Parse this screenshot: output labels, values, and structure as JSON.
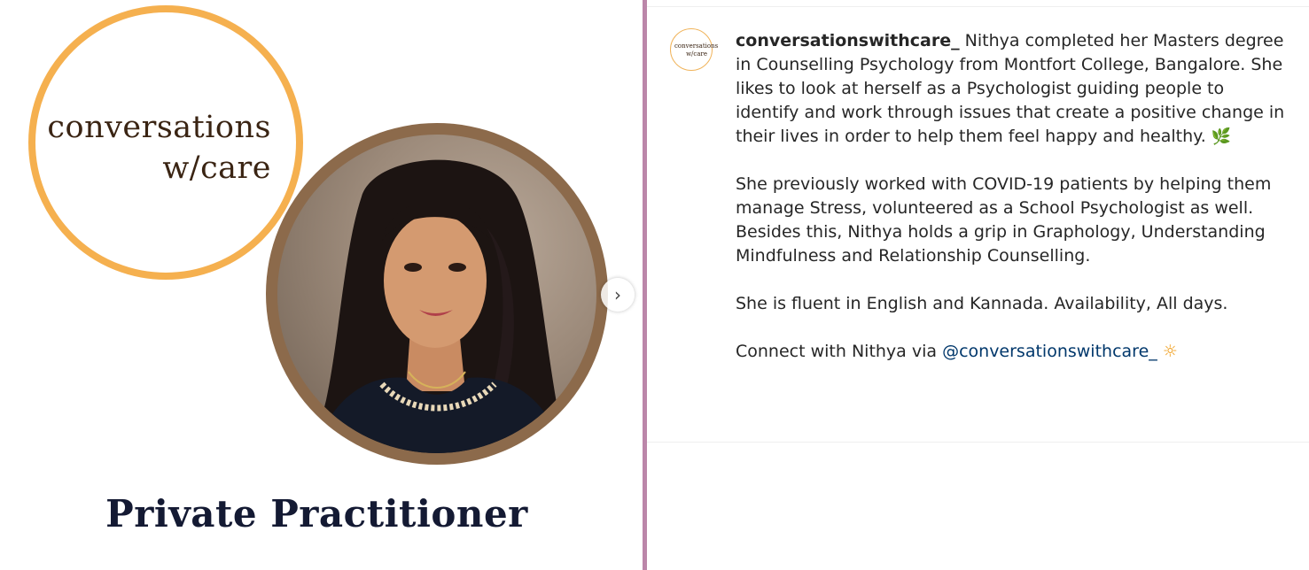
{
  "post": {
    "brand_line1": "conversations",
    "brand_line2": "w/care",
    "title": "Private Practitioner",
    "next_icon": "chevron-right-icon",
    "colors": {
      "brand_ring": "#f5b04f",
      "photo_ring": "#8c6a4b",
      "brand_text": "#3a2413",
      "title_text": "#141a33",
      "divider": "#bb86a9"
    }
  },
  "caption": {
    "avatar_line1": "conversations",
    "avatar_line2": "w/care",
    "username": "conversationswithcare_",
    "p1": "Nithya completed her Masters degree in Counselling Psychology from Montfort College, Bangalore. She likes to look at herself as a Psychologist guiding people to identify and work through issues that create a positive change in their lives in order to help them feel happy and healthy.",
    "p1_emoji": "🌿",
    "p2": "She previously worked with COVID-19 patients by helping them manage Stress, volunteered as a School Psychologist as well. Besides this, Nithya holds a grip in Graphology, Understanding Mindfulness and Relationship Counselling.",
    "p3": "She is fluent in English and Kannada. Availability, All days.",
    "p4_prefix": "Connect with Nithya via",
    "p4_mention": "@conversationswithcare_",
    "p4_emoji": "☼",
    "link_color": "#00376b"
  }
}
